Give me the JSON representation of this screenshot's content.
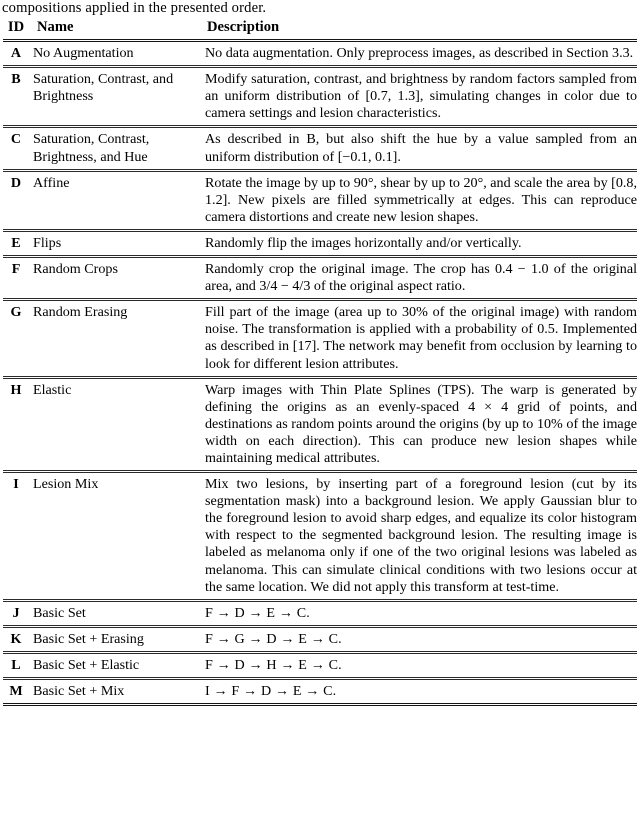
{
  "caption_tail": "compositions applied in the presented order.",
  "table": {
    "columns": [
      "ID",
      "Name",
      "Description"
    ],
    "rows": [
      {
        "id": "A",
        "name": "No Augmentation",
        "description": "No data augmentation. Only preprocess images, as described in Section 3.3."
      },
      {
        "id": "B",
        "name": "Saturation, Contrast, and Brightness",
        "description": "Modify saturation, contrast, and brightness by random factors sampled from an uniform distribution of [0.7, 1.3], simulating changes in color due to camera settings and lesion characteristics."
      },
      {
        "id": "C",
        "name": "Saturation, Contrast, Brightness, and Hue",
        "description": "As described in B, but also shift the hue by a value sampled from an uniform distribution of [−0.1, 0.1]."
      },
      {
        "id": "D",
        "name": "Affine",
        "description": "Rotate the image by up to 90°, shear by up to 20°, and scale the area by [0.8, 1.2]. New pixels are filled symmetrically at edges. This can reproduce camera distortions and create new lesion shapes."
      },
      {
        "id": "E",
        "name": "Flips",
        "description": "Randomly flip the images horizontally and/or vertically."
      },
      {
        "id": "F",
        "name": "Random Crops",
        "description": "Randomly crop the original image. The crop has 0.4 − 1.0 of the original area, and 3/4 − 4/3 of the original aspect ratio."
      },
      {
        "id": "G",
        "name": "Random Erasing",
        "description": "Fill part of the image (area up to 30% of the original image) with random noise. The transformation is applied with a probability of 0.5. Implemented as described in [17]. The network may benefit from occlusion by learning to look for different lesion attributes."
      },
      {
        "id": "H",
        "name": "Elastic",
        "description": "Warp images with Thin Plate Splines (TPS). The warp is generated by defining the origins as an evenly-spaced 4 × 4 grid of points, and destinations as random points around the origins (by up to 10% of the image width on each direction). This can produce new lesion shapes while maintaining medical attributes."
      },
      {
        "id": "I",
        "name": "Lesion Mix",
        "description": "Mix two lesions, by inserting part of a foreground lesion (cut by its segmentation mask) into a background lesion. We apply Gaussian blur to the foreground lesion to avoid sharp edges, and equalize its color histogram with respect to the segmented background lesion. The resulting image is labeled as melanoma only if one of the two original lesions was labeled as melanoma. This can simulate clinical conditions with two lesions occur at the same location. We did not apply this transform at test-time."
      },
      {
        "id": "J",
        "name": "Basic Set",
        "description": "F → D → E → C."
      },
      {
        "id": "K",
        "name": "Basic Set + Erasing",
        "description": "F → G → D → E → C."
      },
      {
        "id": "L",
        "name": "Basic Set + Elastic",
        "description": "F → D → H → E → C."
      },
      {
        "id": "M",
        "name": "Basic Set + Mix",
        "description": "I → F → D → E → C."
      }
    ]
  }
}
